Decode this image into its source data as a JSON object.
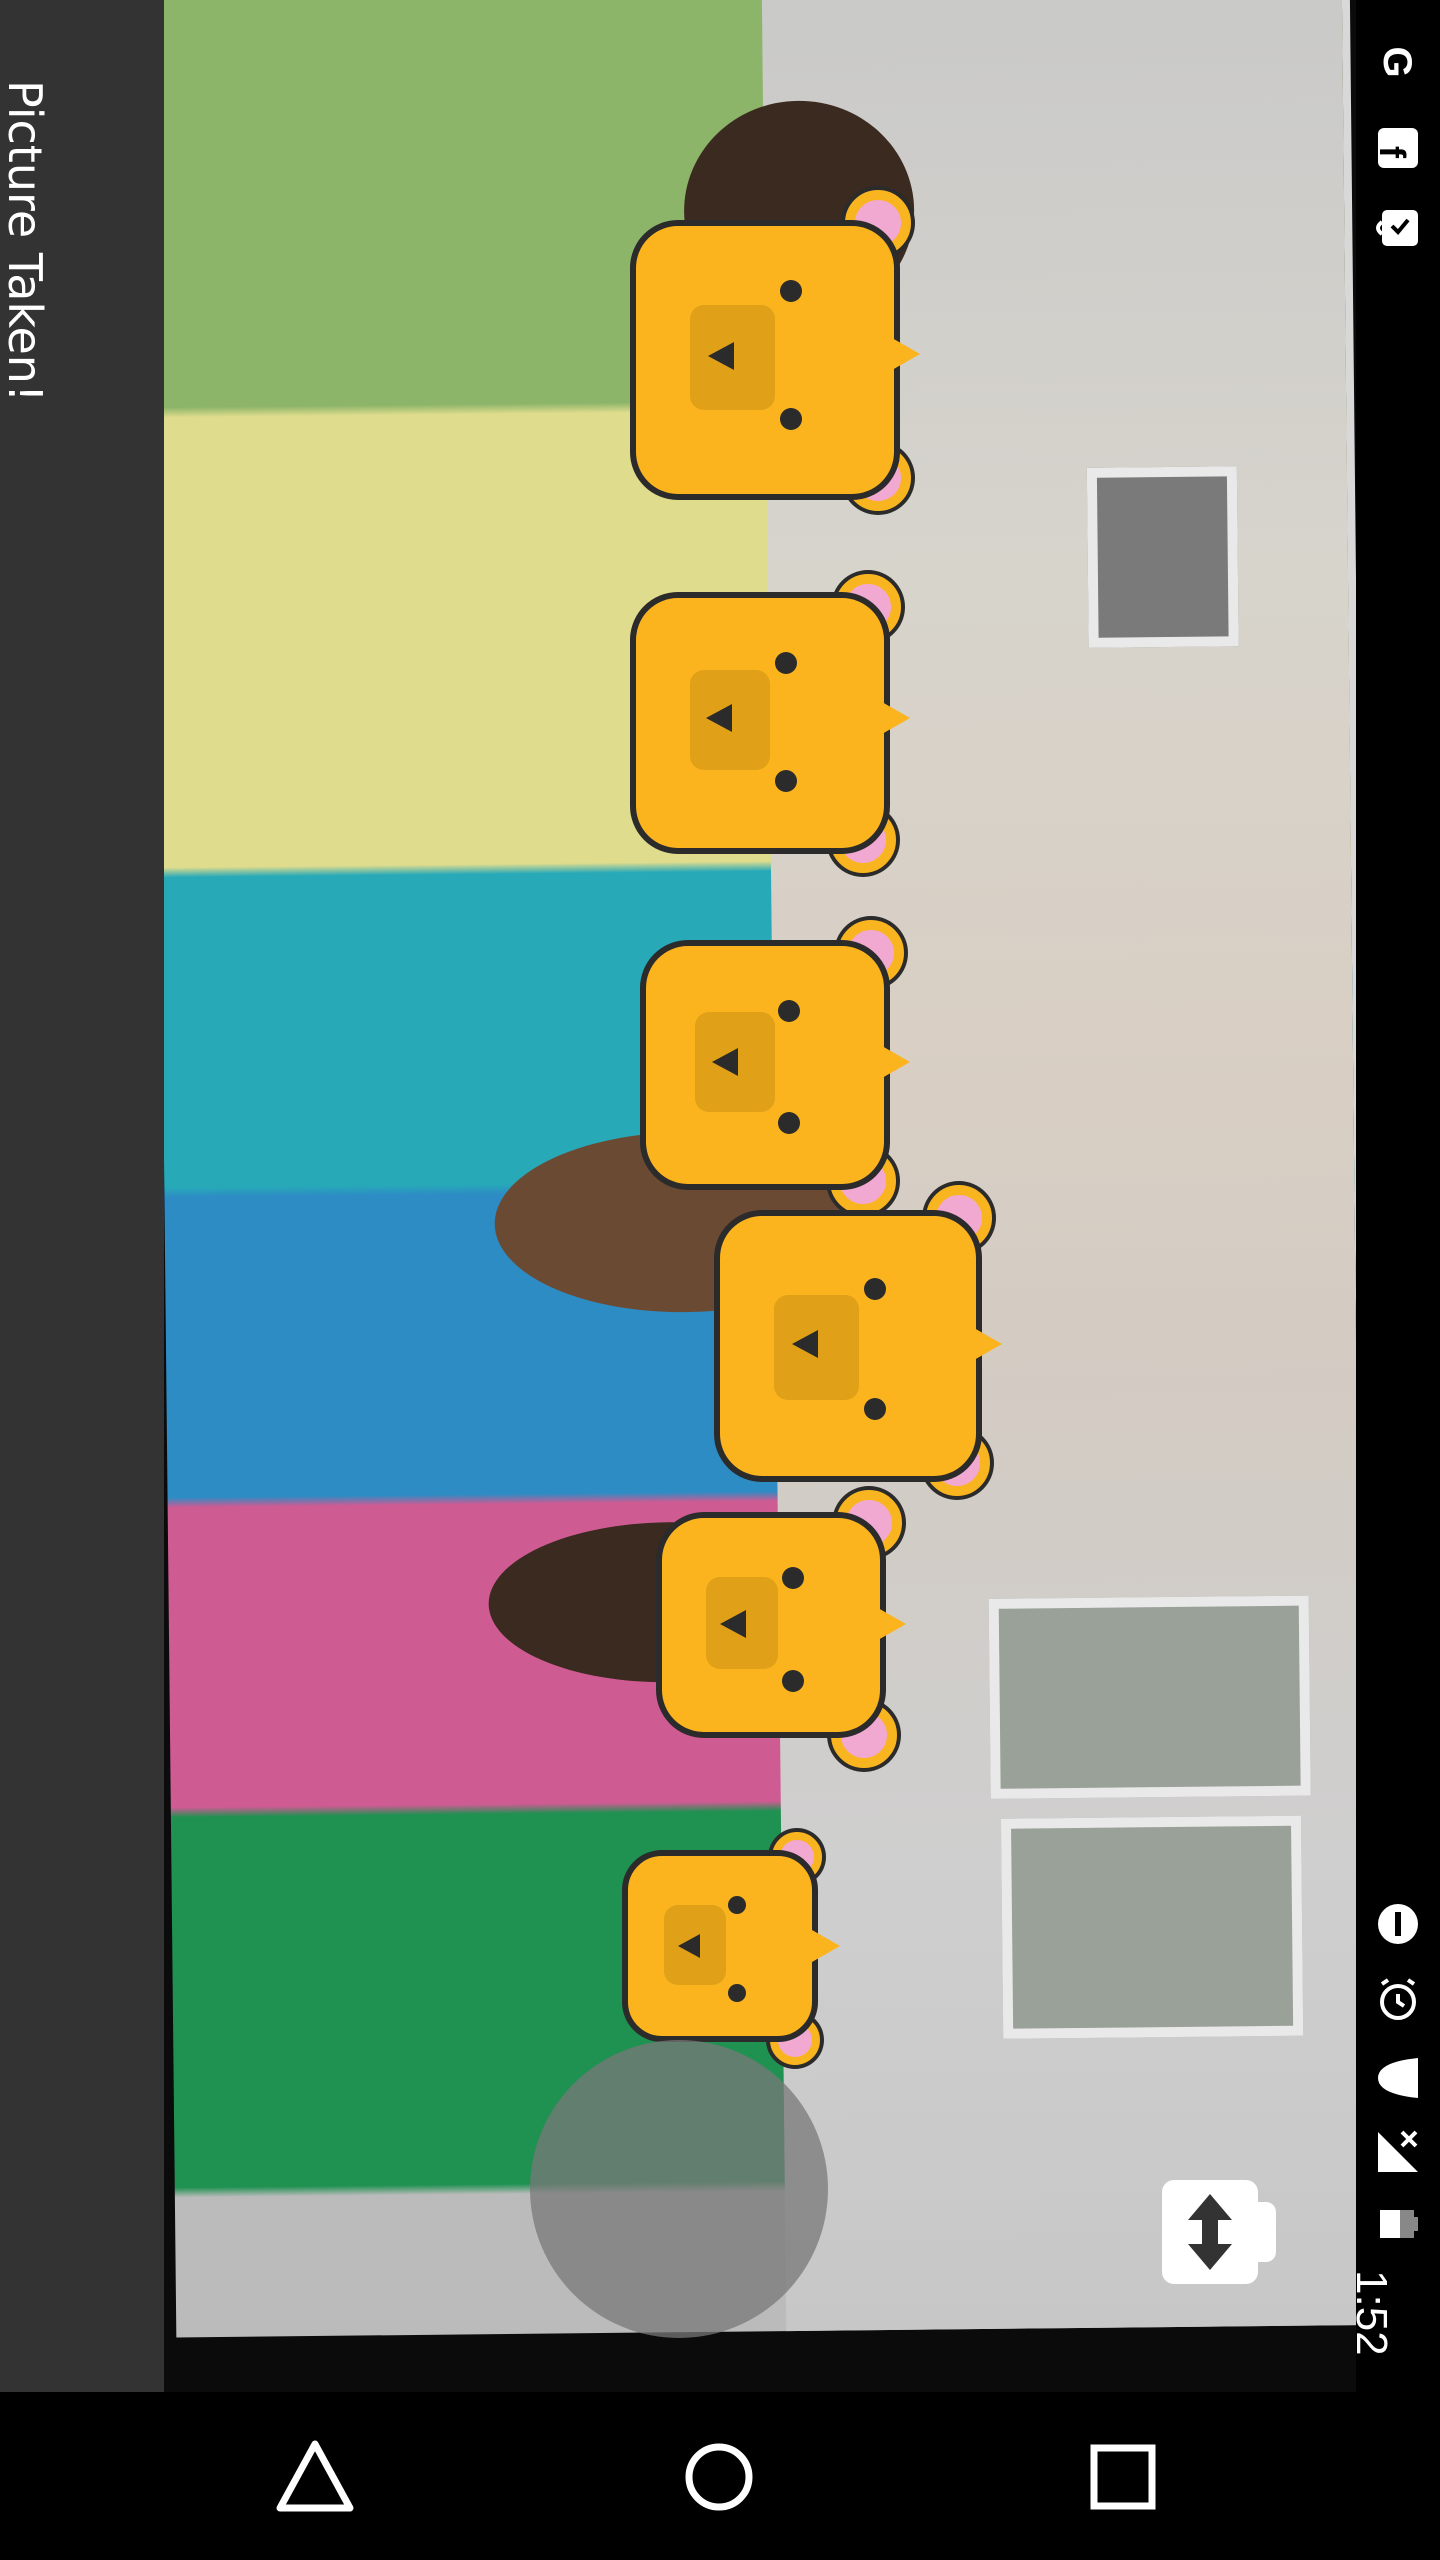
{
  "toast": {
    "message": "Picture Taken!"
  },
  "status_bar": {
    "time": "1:52",
    "icons": [
      "google-icon",
      "facebook-icon",
      "bag-icon",
      "do-not-disturb-icon",
      "alarm-icon",
      "wifi-icon",
      "signal-off-icon",
      "battery-icon"
    ]
  },
  "camera": {
    "faces_detected": 6,
    "overlay": "bear-face",
    "buttons": {
      "shutter": "shutter-button",
      "switch": "switch-camera-button"
    }
  },
  "nav": {
    "back": "back-icon",
    "home": "home-icon",
    "recents": "recents-icon"
  },
  "colors": {
    "bear_fill": "#fbb41d",
    "bear_ear": "#f1a9d2",
    "toast_bg": "#333333",
    "bar_bg": "#000000"
  }
}
